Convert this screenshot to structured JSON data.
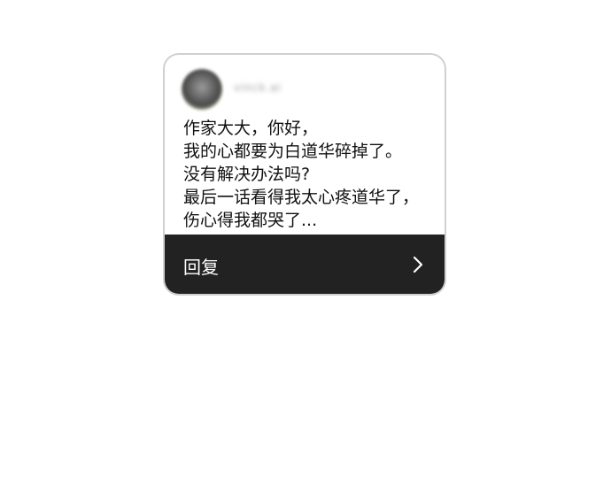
{
  "comment": {
    "username": "vinck.ai",
    "avatar_icon": "user-avatar-icon",
    "message_lines": [
      "作家大大，你好，",
      "我的心都要为白道华碎掉了。",
      "没有解决办法吗?",
      "最后一话看得我太心疼道华了，",
      "伤心得我都哭了..."
    ]
  },
  "reply": {
    "label": "回复",
    "icon": "chevron-right-icon"
  },
  "colors": {
    "reply_bar": "#222222",
    "card_border": "#d0d0d0",
    "text": "#111111"
  }
}
